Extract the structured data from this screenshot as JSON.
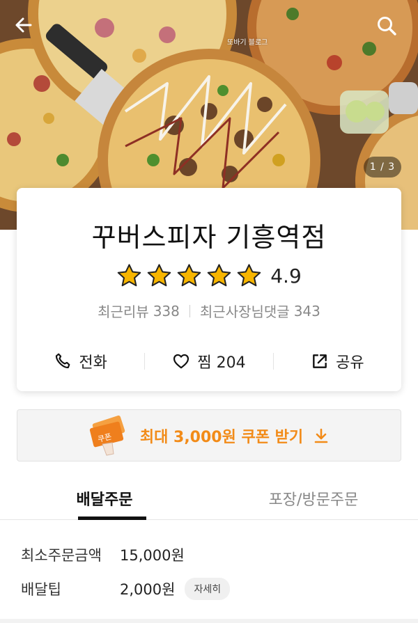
{
  "hero": {
    "watermark": "또바기 블로그",
    "counter": "1 / 3"
  },
  "store": {
    "name": "꾸버스피자 기흥역점",
    "rating": "4.9",
    "star_count": 5,
    "recent_reviews_label": "최근리뷰",
    "recent_reviews_count": "338",
    "owner_replies_label": "최근사장님댓글",
    "owner_replies_count": "343"
  },
  "actions": {
    "call_label": "전화",
    "like_label": "찜 204",
    "share_label": "공유"
  },
  "coupon": {
    "label": "최대 3,000원 쿠폰 받기",
    "ticket_text": "쿠폰"
  },
  "tabs": [
    {
      "label": "배달주문",
      "active": true
    },
    {
      "label": "포장/방문주문",
      "active": false
    }
  ],
  "delivery": {
    "min_order_label": "최소주문금액",
    "min_order_value": "15,000원",
    "tip_label": "배달팁",
    "tip_value": "2,000원",
    "detail_button": "자세히"
  },
  "colors": {
    "accent": "#f28b18",
    "star": "#f7b500"
  }
}
